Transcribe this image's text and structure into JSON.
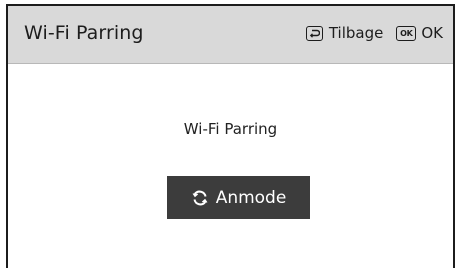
{
  "header": {
    "title": "Wi-Fi Parring",
    "back_label": "Tilbage",
    "ok_key_text": "OK",
    "ok_label": "OK"
  },
  "main": {
    "label": "Wi-Fi Parring",
    "pair_button_label": "Anmode"
  },
  "icons": {
    "back": "back-key-icon",
    "ok": "ok-key-icon",
    "pair": "refresh-icon"
  }
}
